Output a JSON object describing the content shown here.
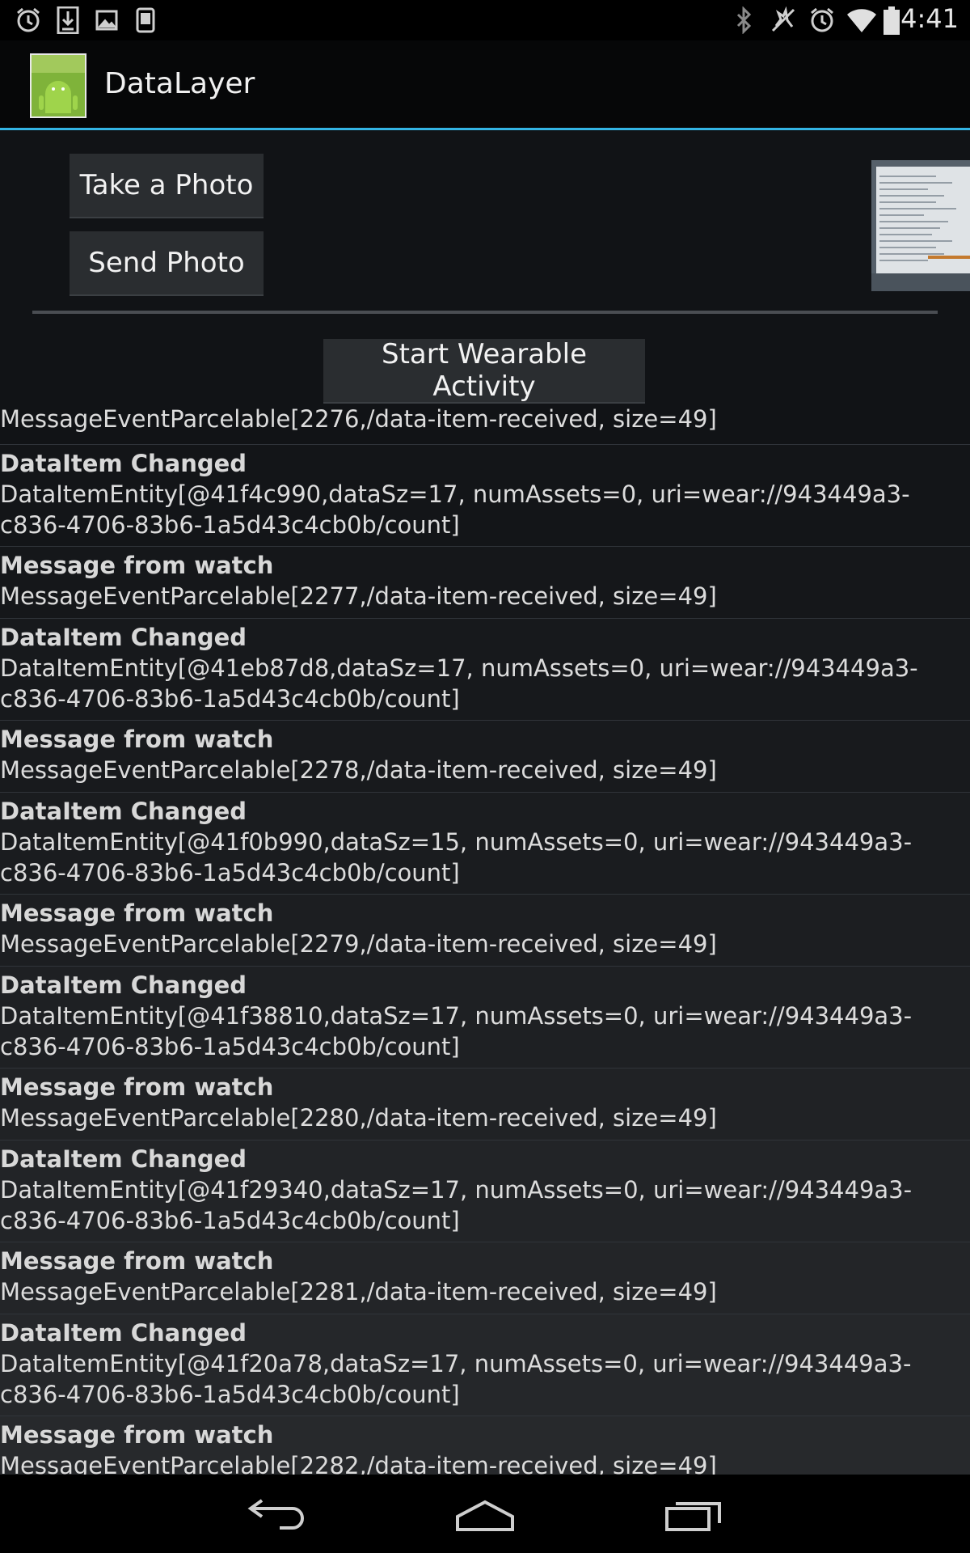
{
  "status_bar": {
    "time": "4:41",
    "left_icons": [
      "alarm-icon",
      "download-icon",
      "image-icon",
      "device-icon"
    ],
    "right_icons": [
      "bluetooth-icon",
      "mute-icon",
      "alarm-icon",
      "wifi-icon",
      "battery-icon"
    ]
  },
  "action_bar": {
    "title": "DataLayer",
    "accent_color": "#33b5e5"
  },
  "buttons": {
    "take_photo": "Take a Photo",
    "send_photo": "Send Photo",
    "start_wearable": "Start Wearable Activity"
  },
  "log": {
    "first_line": "MessageEventParcelable[2276,/data-item-received, size=49]",
    "entries": [
      {
        "title": "DataItem Changed",
        "detail": "DataItemEntity[@41f4c990,dataSz=17, numAssets=0, uri=wear://943449a3-\nc836-4706-83b6-1a5d43c4cb0b/count]"
      },
      {
        "title": "Message from watch",
        "detail": "MessageEventParcelable[2277,/data-item-received, size=49]"
      },
      {
        "title": "DataItem Changed",
        "detail": "DataItemEntity[@41eb87d8,dataSz=17, numAssets=0, uri=wear://943449a3-\nc836-4706-83b6-1a5d43c4cb0b/count]"
      },
      {
        "title": "Message from watch",
        "detail": "MessageEventParcelable[2278,/data-item-received, size=49]"
      },
      {
        "title": "DataItem Changed",
        "detail": "DataItemEntity[@41f0b990,dataSz=15, numAssets=0, uri=wear://943449a3-\nc836-4706-83b6-1a5d43c4cb0b/count]"
      },
      {
        "title": "Message from watch",
        "detail": "MessageEventParcelable[2279,/data-item-received, size=49]"
      },
      {
        "title": "DataItem Changed",
        "detail": "DataItemEntity[@41f38810,dataSz=17, numAssets=0, uri=wear://943449a3-\nc836-4706-83b6-1a5d43c4cb0b/count]"
      },
      {
        "title": "Message from watch",
        "detail": "MessageEventParcelable[2280,/data-item-received, size=49]"
      },
      {
        "title": "DataItem Changed",
        "detail": "DataItemEntity[@41f29340,dataSz=17, numAssets=0, uri=wear://943449a3-\nc836-4706-83b6-1a5d43c4cb0b/count]"
      },
      {
        "title": "Message from watch",
        "detail": "MessageEventParcelable[2281,/data-item-received, size=49]"
      },
      {
        "title": "DataItem Changed",
        "detail": "DataItemEntity[@41f20a78,dataSz=17, numAssets=0, uri=wear://943449a3-\nc836-4706-83b6-1a5d43c4cb0b/count]"
      },
      {
        "title": "Message from watch",
        "detail": "MessageEventParcelable[2282,/data-item-received, size=49]"
      }
    ]
  },
  "nav_bar": {
    "icons": [
      "back-icon",
      "home-icon",
      "recent-apps-icon"
    ]
  }
}
